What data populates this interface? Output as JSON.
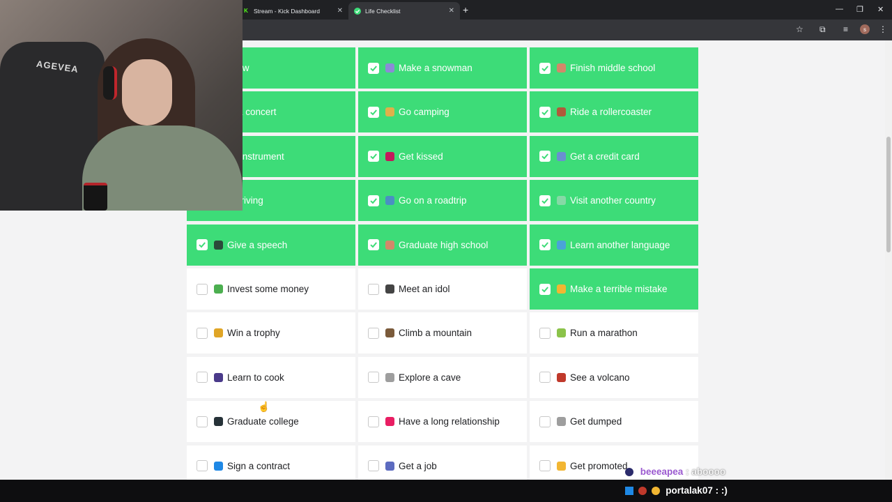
{
  "browser": {
    "tabs": [
      {
        "title": "Stream - Kick Dashboard",
        "active": false,
        "favicon": "kick-logo-icon",
        "favicon_color": "#53fc18"
      },
      {
        "title": "Life Checklist",
        "active": true,
        "favicon": "check-circle-icon",
        "favicon_color": "#3ddc78"
      }
    ],
    "profile_initial": "s"
  },
  "checklist": {
    "done_color": "#3ddc78",
    "rows": [
      [
        {
          "label": "snow",
          "done": true,
          "icon": "snowflake-icon",
          "emoji_color": "#3ddc78"
        },
        {
          "label": "Make a snowman",
          "done": true,
          "icon": "snowman-icon",
          "emoji_color": "#8b8bd6"
        },
        {
          "label": "Finish middle school",
          "done": true,
          "icon": "school-icon",
          "emoji_color": "#d2886a"
        }
      ],
      [
        {
          "label": "to a concert",
          "done": true,
          "icon": "music-icon",
          "emoji_color": "#3ddc78"
        },
        {
          "label": "Go camping",
          "done": true,
          "icon": "camping-icon",
          "emoji_color": "#e0b04a"
        },
        {
          "label": "Ride a rollercoaster",
          "done": true,
          "icon": "rollercoaster-icon",
          "emoji_color": "#b05a3a"
        }
      ],
      [
        {
          "label": "an instrument",
          "done": true,
          "icon": "guitar-icon",
          "emoji_color": "#b03030"
        },
        {
          "label": "Get kissed",
          "done": true,
          "icon": "lips-icon",
          "emoji_color": "#c2185b"
        },
        {
          "label": "Get a credit card",
          "done": true,
          "icon": "credit-card-icon",
          "emoji_color": "#6a8fd0"
        }
      ],
      [
        {
          "label": "rt driving",
          "done": true,
          "icon": "car-icon",
          "emoji_color": "#3ddc78"
        },
        {
          "label": "Go on a roadtrip",
          "done": true,
          "icon": "map-icon",
          "emoji_color": "#4a90c2"
        },
        {
          "label": "Visit another country",
          "done": true,
          "icon": "plane-icon",
          "emoji_color": "#86d9a6"
        }
      ],
      [
        {
          "label": "Give a speech",
          "done": true,
          "icon": "microphone-icon",
          "emoji_color": "#2b4a3a"
        },
        {
          "label": "Graduate high school",
          "done": true,
          "icon": "school-icon",
          "emoji_color": "#d2886a"
        },
        {
          "label": "Learn another language",
          "done": true,
          "icon": "globe-icon",
          "emoji_color": "#4aa3d8"
        }
      ],
      [
        {
          "label": "Invest some money",
          "done": false,
          "icon": "money-icon",
          "emoji_color": "#4caf50"
        },
        {
          "label": "Meet an idol",
          "done": false,
          "icon": "camera-icon",
          "emoji_color": "#444444"
        },
        {
          "label": "Make a terrible mistake",
          "done": true,
          "icon": "grimace-face-icon",
          "emoji_color": "#f2b632"
        }
      ],
      [
        {
          "label": "Win a trophy",
          "done": false,
          "icon": "trophy-icon",
          "emoji_color": "#e0a526"
        },
        {
          "label": "Climb a mountain",
          "done": false,
          "icon": "mountain-icon",
          "emoji_color": "#7a5a3a"
        },
        {
          "label": "Run a marathon",
          "done": false,
          "icon": "running-icon",
          "emoji_color": "#8bc34a"
        }
      ],
      [
        {
          "label": "Learn to cook",
          "done": false,
          "icon": "magnifier-icon",
          "emoji_color": "#4a3a8a"
        },
        {
          "label": "Explore a cave",
          "done": false,
          "icon": "pickaxe-icon",
          "emoji_color": "#9e9e9e"
        },
        {
          "label": "See a volcano",
          "done": false,
          "icon": "volcano-icon",
          "emoji_color": "#c0392b"
        }
      ],
      [
        {
          "label": "Graduate college",
          "done": false,
          "icon": "graduation-cap-icon",
          "emoji_color": "#263238"
        },
        {
          "label": "Have a long relationship",
          "done": false,
          "icon": "hearts-icon",
          "emoji_color": "#e91e63"
        },
        {
          "label": "Get dumped",
          "done": false,
          "icon": "trash-icon",
          "emoji_color": "#9e9e9e"
        }
      ],
      [
        {
          "label": "Sign a contract",
          "done": false,
          "icon": "pen-icon",
          "emoji_color": "#1e88e5"
        },
        {
          "label": "Get a job",
          "done": false,
          "icon": "building-icon",
          "emoji_color": "#5c6bc0"
        },
        {
          "label": "Get promoted",
          "done": false,
          "icon": "pointing-up-icon",
          "emoji_color": "#f2b632"
        }
      ]
    ]
  },
  "webcam": {
    "chair_brand": "AGEVEA"
  },
  "chat_overlay": [
    {
      "user": "beeeapea",
      "message": ": aboooo",
      "user_color": "#9b59d0"
    },
    {
      "user": "portalak07",
      "message": ": :)",
      "user_color": "#ffffff"
    }
  ]
}
